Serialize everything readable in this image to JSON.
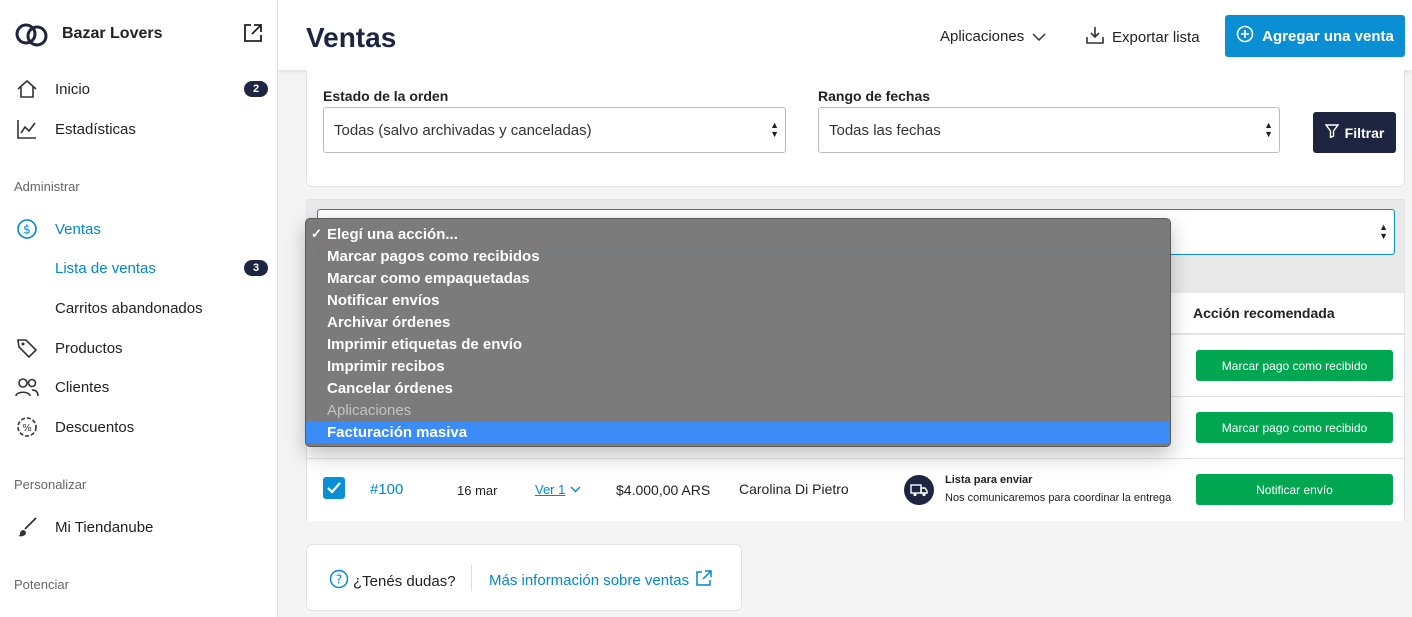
{
  "sidebar": {
    "store_name": "Bazar Lovers",
    "items": [
      {
        "label": "Inicio",
        "badge": "2"
      },
      {
        "label": "Estadísticas"
      }
    ],
    "sections": {
      "administrar": "Administrar",
      "personalizar": "Personalizar",
      "potenciar": "Potenciar"
    },
    "ventas": {
      "label": "Ventas",
      "lista": {
        "label": "Lista de ventas",
        "badge": "3"
      },
      "carritos": {
        "label": "Carritos abandonados"
      }
    },
    "productos": "Productos",
    "clientes": "Clientes",
    "descuentos": "Descuentos",
    "mi_tienda": "Mi Tiendanube"
  },
  "header": {
    "title": "Ventas",
    "apps_label": "Aplicaciones",
    "export_label": "Exportar lista",
    "add_label": "Agregar una venta"
  },
  "filters": {
    "estado_label": "Estado de la orden",
    "estado_value": "Todas (salvo archivadas y canceladas)",
    "rango_label": "Rango de fechas",
    "rango_value": "Todas las fechas",
    "filter_label": "Filtrar"
  },
  "table": {
    "recommended_header": "Acción recomendada",
    "rows": [
      {
        "action": "Marcar pago como recibido"
      },
      {
        "action": "Marcar pago como recibido"
      },
      {
        "order": "#100",
        "date": "16 mar",
        "view": "Ver 1",
        "total": "$4.000,00 ARS",
        "customer": "Carolina Di Pietro",
        "ship_title": "Lista para enviar",
        "ship_desc": "Nos comunicaremos para coordinar la entrega",
        "action": "Notificar envío"
      }
    ]
  },
  "bulk_dropdown": {
    "options": [
      "Elegí una acción...",
      "Marcar pagos como recibidos",
      "Marcar como empaquetadas",
      "Notificar envíos",
      "Archivar órdenes",
      "Imprimir etiquetas de envío",
      "Imprimir recibos",
      "Cancelar órdenes",
      "Aplicaciones",
      "Facturación masiva"
    ]
  },
  "help": {
    "question": "¿Tenés dudas?",
    "link": "Más información sobre ventas"
  },
  "colors": {
    "accent": "#0b8fd4",
    "navy": "#1e2540",
    "green": "#00a650",
    "selected": "#3b8cf6"
  }
}
